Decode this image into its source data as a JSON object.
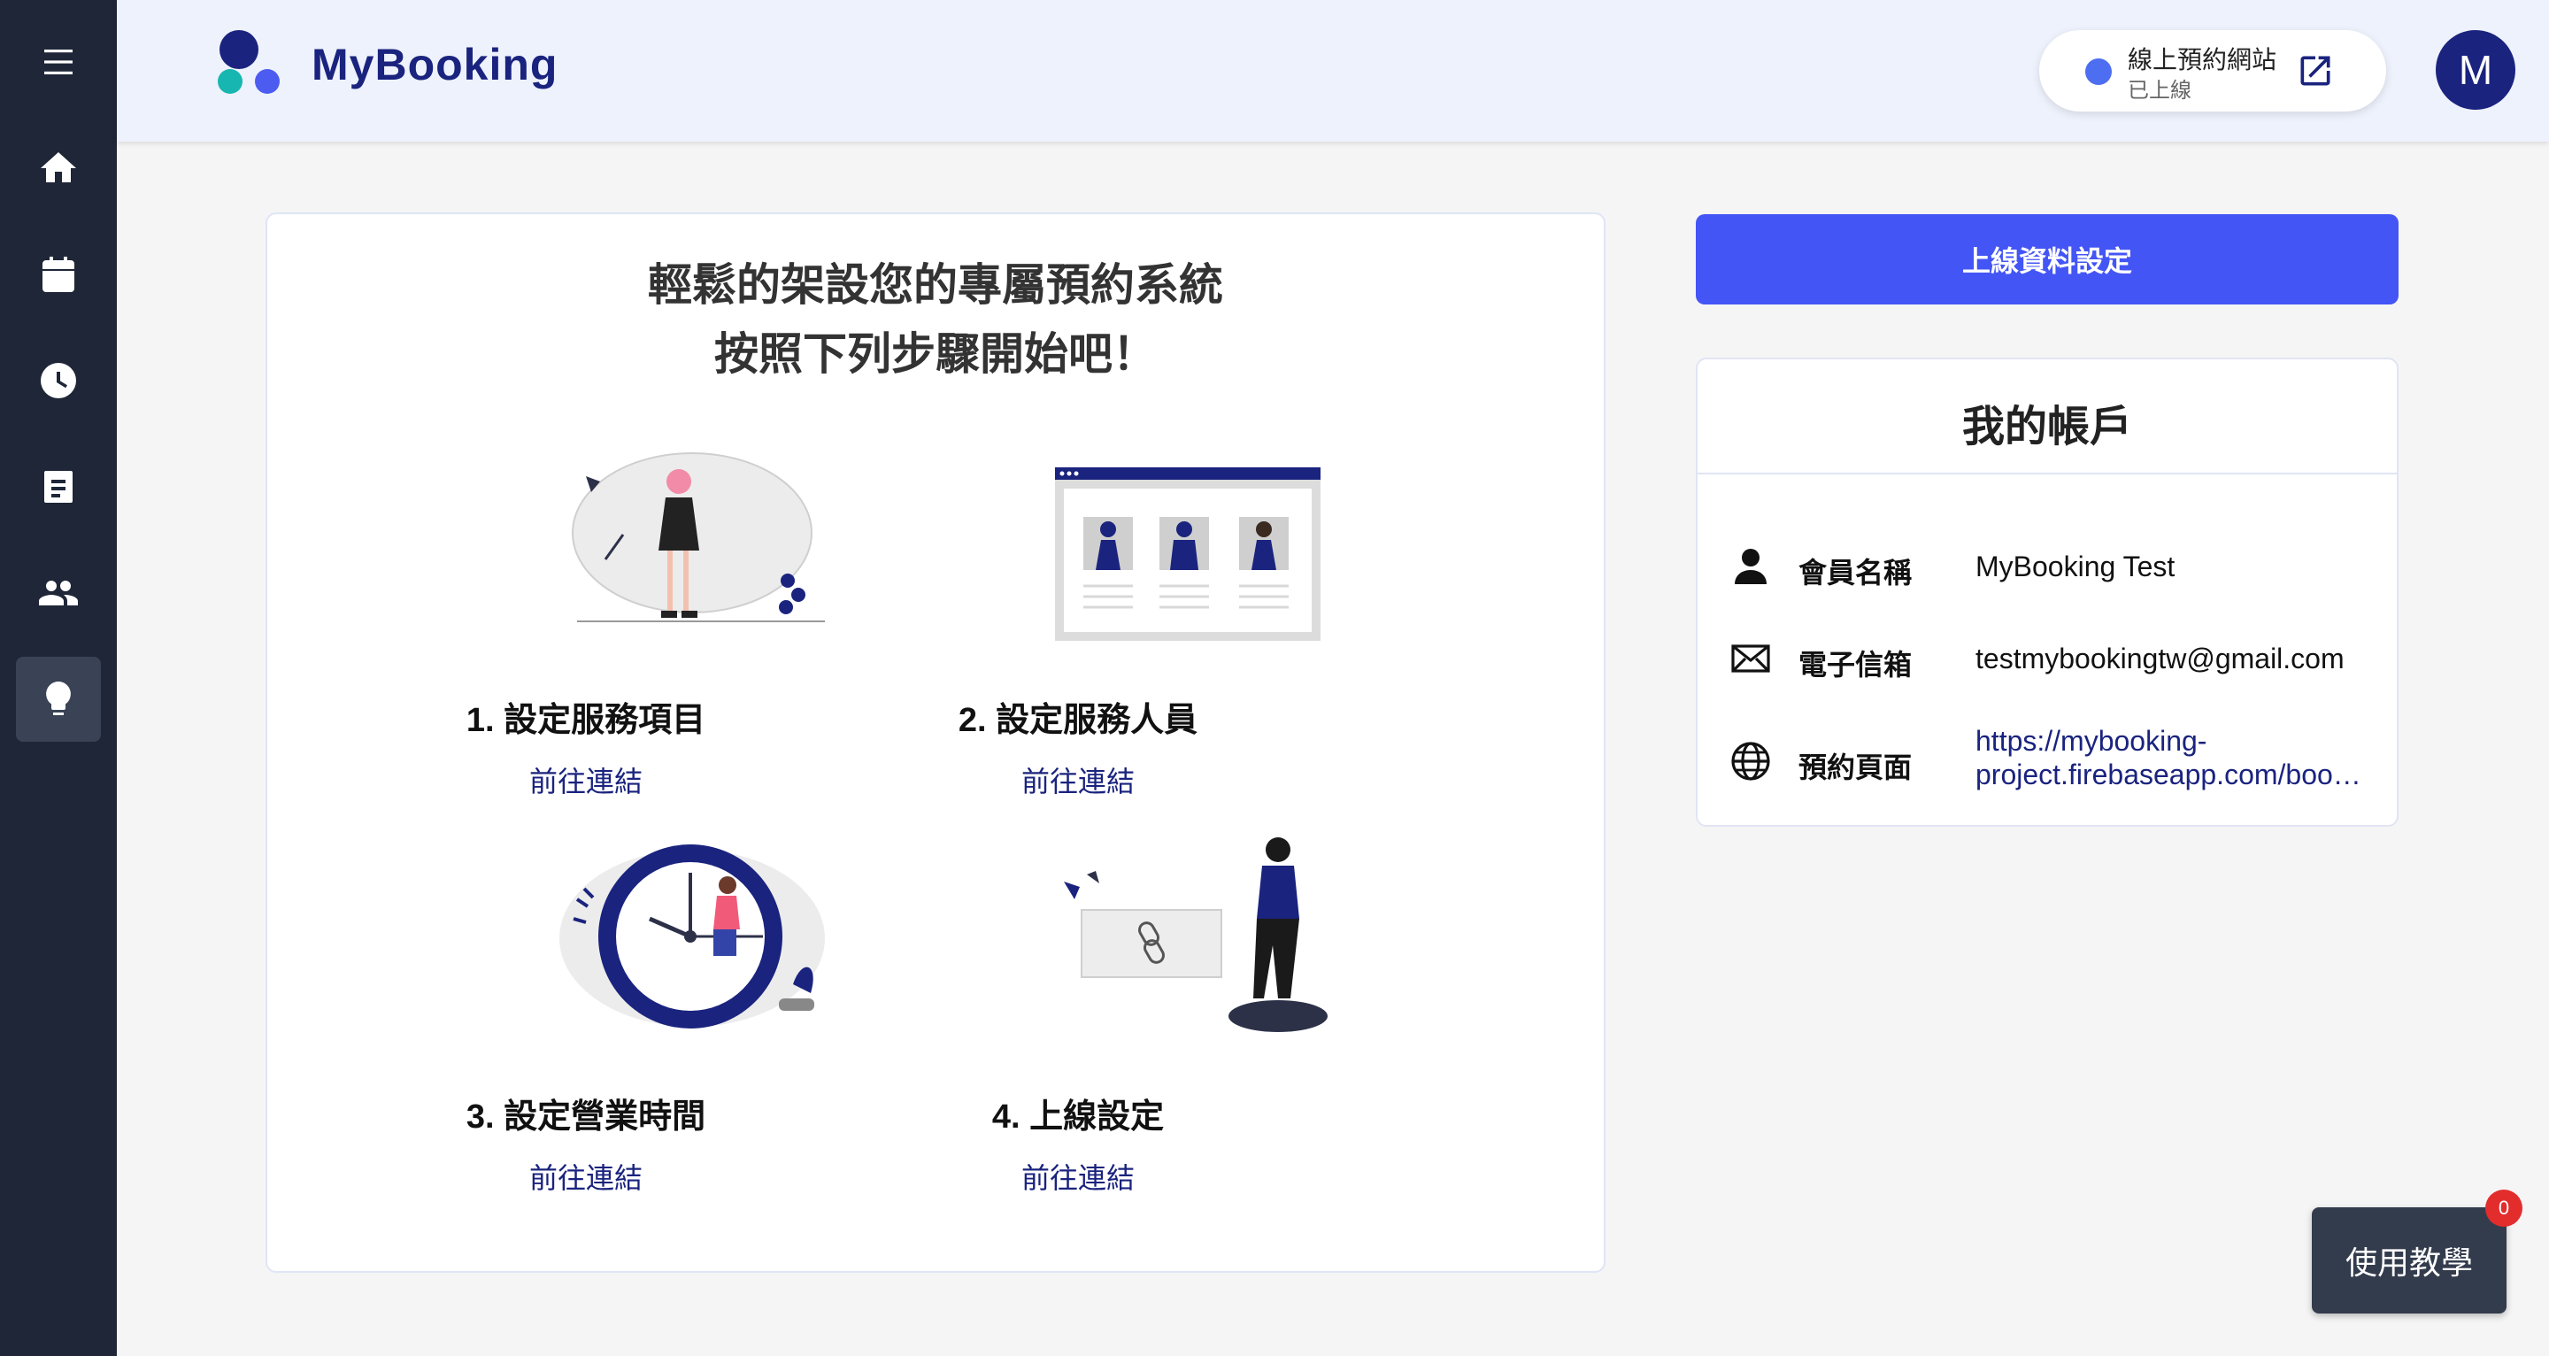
{
  "app": {
    "brand": "MyBooking",
    "logo_caption": "MYBOOKING"
  },
  "sidebar": {
    "items": [
      {
        "name": "menu-icon"
      },
      {
        "name": "home-icon"
      },
      {
        "name": "calendar-icon"
      },
      {
        "name": "clock-icon"
      },
      {
        "name": "document-icon"
      },
      {
        "name": "people-icon"
      },
      {
        "name": "lightbulb-icon",
        "active": true
      }
    ]
  },
  "header": {
    "site_title": "線上預約網站",
    "site_status": "已上線",
    "avatar_letter": "M"
  },
  "main": {
    "headline_1": "輕鬆的架設您的專屬預約系統",
    "headline_2": "按照下列步驟開始吧！",
    "steps": [
      {
        "title": "1. 設定服務項目",
        "link": "前往連結"
      },
      {
        "title": "2. 設定服務人員",
        "link": "前往連結"
      },
      {
        "title": "3. 設定營業時間",
        "link": "前往連結"
      },
      {
        "title": "4. 上線設定",
        "link": "前往連結"
      }
    ]
  },
  "side": {
    "publish_button": "上線資料設定",
    "account": {
      "title": "我的帳戶",
      "rows": [
        {
          "label": "會員名稱",
          "value": "MyBooking Test",
          "icon": "person-icon"
        },
        {
          "label": "電子信箱",
          "value": "testmybookingtw@gmail.com",
          "icon": "mail-icon"
        },
        {
          "label": "預約頁面",
          "value_line1": "https://mybooking-",
          "value_line2": "project.firebaseapp.com/boo…",
          "icon": "globe-icon"
        }
      ]
    }
  },
  "help": {
    "label": "使用教學",
    "badge_count": "0"
  },
  "colors": {
    "sidebar": "#1e2638",
    "brand": "#1a237e",
    "accent": "#4355f5",
    "teal": "#18b6b0",
    "badge": "#e32d2d"
  }
}
